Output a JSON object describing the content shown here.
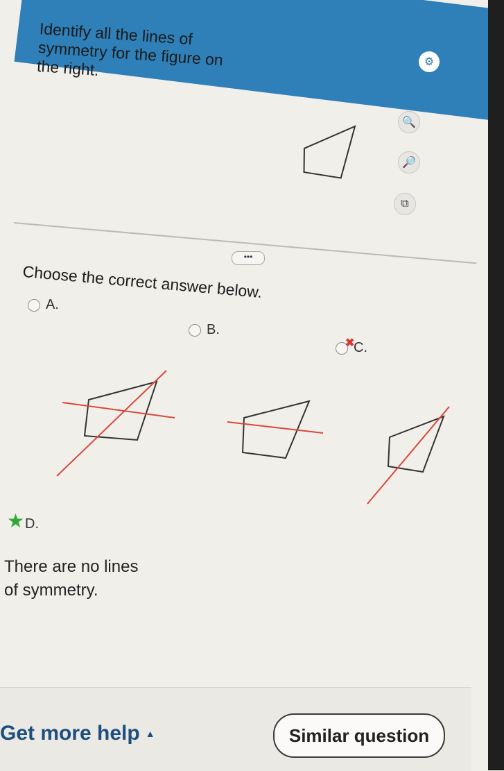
{
  "question": {
    "text": "Identify all the lines of symmetry for the figure on the right."
  },
  "tools": {
    "settings_icon": "gear-icon",
    "zoom_in_icon": "zoom-in-icon",
    "zoom_out_icon": "zoom-out-icon",
    "popout_icon": "popout-icon"
  },
  "more_button": {
    "label": "•••"
  },
  "answer": {
    "prompt": "Choose the correct answer below.",
    "options": [
      {
        "letter": "A."
      },
      {
        "letter": "B."
      },
      {
        "letter": "C."
      },
      {
        "letter": "D.",
        "text": "There are no lines of symmetry."
      }
    ]
  },
  "footer": {
    "help_label": "Get more help",
    "similar_label": "Similar question"
  },
  "colors": {
    "header": "#2f7fb8",
    "symmetry_line": "#d9483b",
    "wrong_mark": "#d63a2e",
    "correct_star": "#2fa83a"
  }
}
